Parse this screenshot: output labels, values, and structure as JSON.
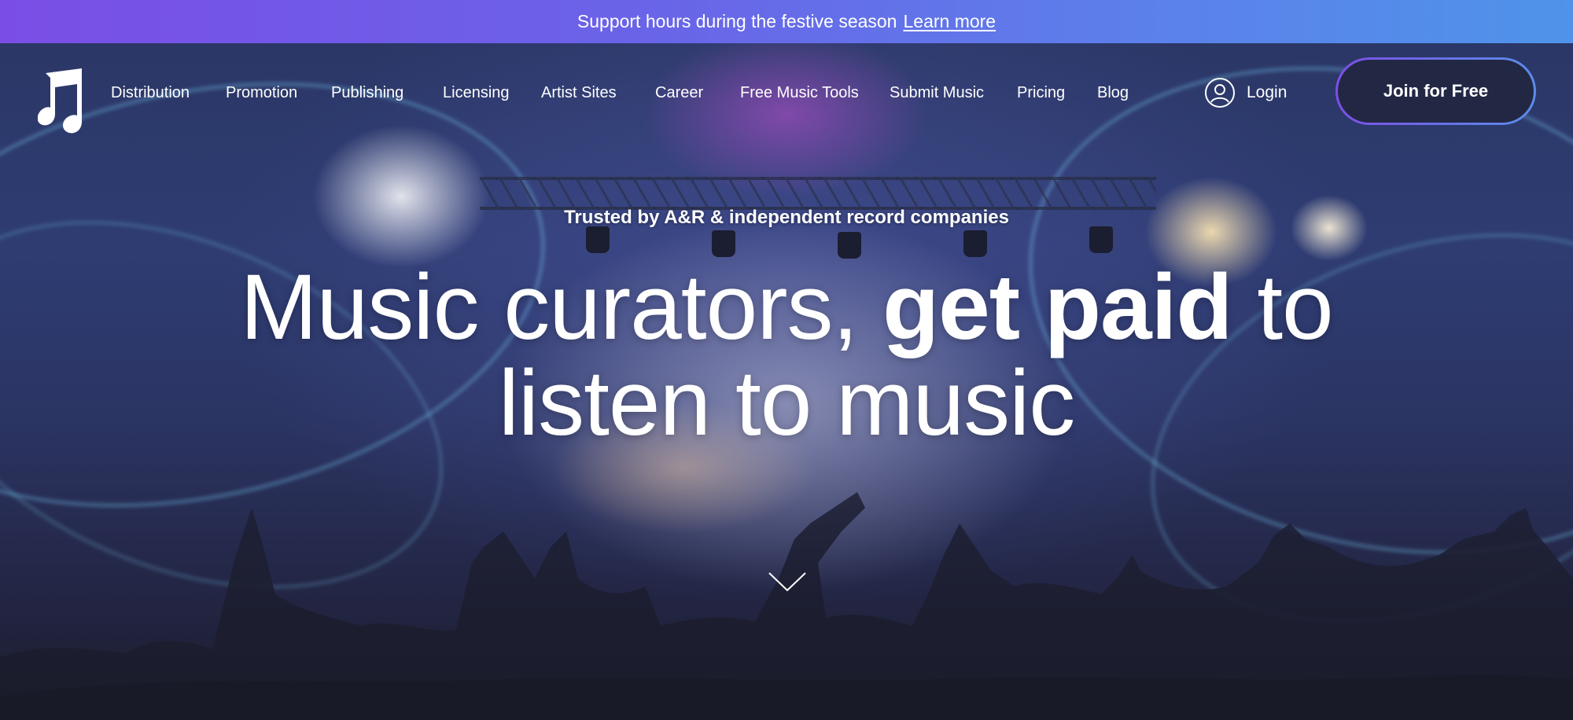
{
  "announcement": {
    "message": "Support hours during the festive season",
    "link_label": "Learn more"
  },
  "nav": {
    "logo_icon": "music-note-icon",
    "items": [
      {
        "label": "Distribution"
      },
      {
        "label": "Promotion"
      },
      {
        "label": "Publishing"
      },
      {
        "label": "Licensing"
      },
      {
        "label": "Artist Sites"
      },
      {
        "label": "Career"
      },
      {
        "label": "Free Music Tools"
      },
      {
        "label": "Submit Music"
      },
      {
        "label": "Pricing"
      },
      {
        "label": "Blog"
      }
    ],
    "login_label": "Login",
    "login_icon": "user-circle-icon",
    "join_label": "Join for Free"
  },
  "hero": {
    "tagline": "Trusted by A&R & independent record companies",
    "headline_part1": "Music curators, ",
    "headline_bold": "get paid",
    "headline_part2": " to",
    "headline_line2": "listen to music",
    "scroll_icon": "chevron-down-icon"
  },
  "colors": {
    "announce_gradient_start": "#7a4ee6",
    "announce_gradient_end": "#4f93ea",
    "text": "#ffffff",
    "button_border_start": "#7c4fe6",
    "button_border_end": "#5a8dea"
  }
}
